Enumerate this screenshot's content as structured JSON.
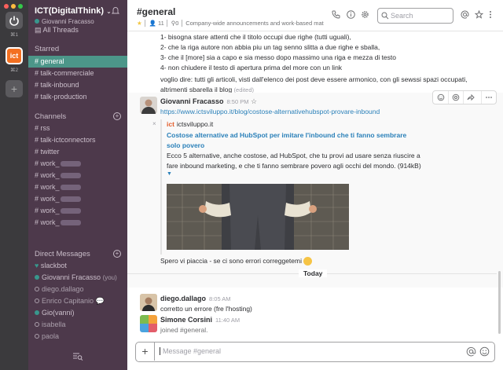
{
  "teams": {
    "shortcut_1": "⌘1",
    "shortcut_2": "⌘2",
    "logo_text": "ict",
    "add": "+"
  },
  "sidebar": {
    "team_name": "ICT(DigitalThink)",
    "team_caret": "⌄",
    "user": "Giovanni Fracasso",
    "all_threads": "All Threads",
    "starred_header": "Starred",
    "starred": [
      "# general",
      "# talk-commerciale",
      "# talk-inbound",
      "# talk-production"
    ],
    "channels_header": "Channels",
    "channels": [
      "# rss",
      "# talk-ictconnectors",
      "# twitter",
      "# work_",
      "# work_",
      "# work_",
      "# work_",
      "# work_",
      "# work_"
    ],
    "dm_header": "Direct Messages",
    "dms": {
      "slackbot": "slackbot",
      "giovanni": "Giovanni Fracasso",
      "you_tag": "(you)",
      "diego": "diego.dallago",
      "enrico": "Enrico Capitanio",
      "giovanni2": "Gio(vanni)",
      "isabella": "isabella",
      "paola": "paola"
    }
  },
  "header": {
    "channel": "#general",
    "members": "11",
    "pins": "0",
    "topic": "Company-wide announcements and work-based mat",
    "search_placeholder": "Search"
  },
  "messages": {
    "list_lines": [
      "1- bisogna stare attenti che il titolo occupi due righe (tutti uguali),",
      "2- che la riga autore non abbia piu un tag senno slitta a due righe e sballa,",
      "3- che il [more] sia a capo e sia messo dopo  massimo una riga e mezza di testo",
      "4- non chiudere il testo di apertura prima del more con un link"
    ],
    "para_1": "voglio dire: tutti gli articoli, visti dall'elenco dei post deve essere armonico, con gli sewssi spazi occupati,",
    "para_2": "altrimenti sbarella il blog",
    "edited": "(edited)",
    "m1": {
      "author": "Giovanni Fracasso",
      "time": "8:50 PM",
      "link": "https://www.ictsviluppo.it/blog/costose-alternativehubspot-provare-inbound",
      "site_logo": "ict",
      "site": "ictsviluppo.it",
      "att_title": "Costose alternative ad HubSpot per imitare l'inbound che ti fanno sembrare solo povero",
      "att_text": "Ecco 5 alternative, anche costose, ad HubSpot, che tu provi ad usare senza riuscire a fare inbound marketing, e che ti fanno sembrare povero agli occhi del mondo. (914kB)",
      "caption": "Spero vi piaccia - se ci sono errori correggetemi"
    },
    "day": "Today",
    "m2": {
      "author": "diego.dallago",
      "time": "8:05 AM",
      "text": "corretto un errore (fre l'hosting)"
    },
    "m3": {
      "author": "Simone Corsini",
      "time": "11:40 AM",
      "text": "joined #general."
    }
  },
  "composer": {
    "placeholder": "Message #general",
    "plus": "+"
  },
  "colors": {
    "sidebar": "#4d394b",
    "active": "#4c9689",
    "link": "#2a80b9"
  }
}
